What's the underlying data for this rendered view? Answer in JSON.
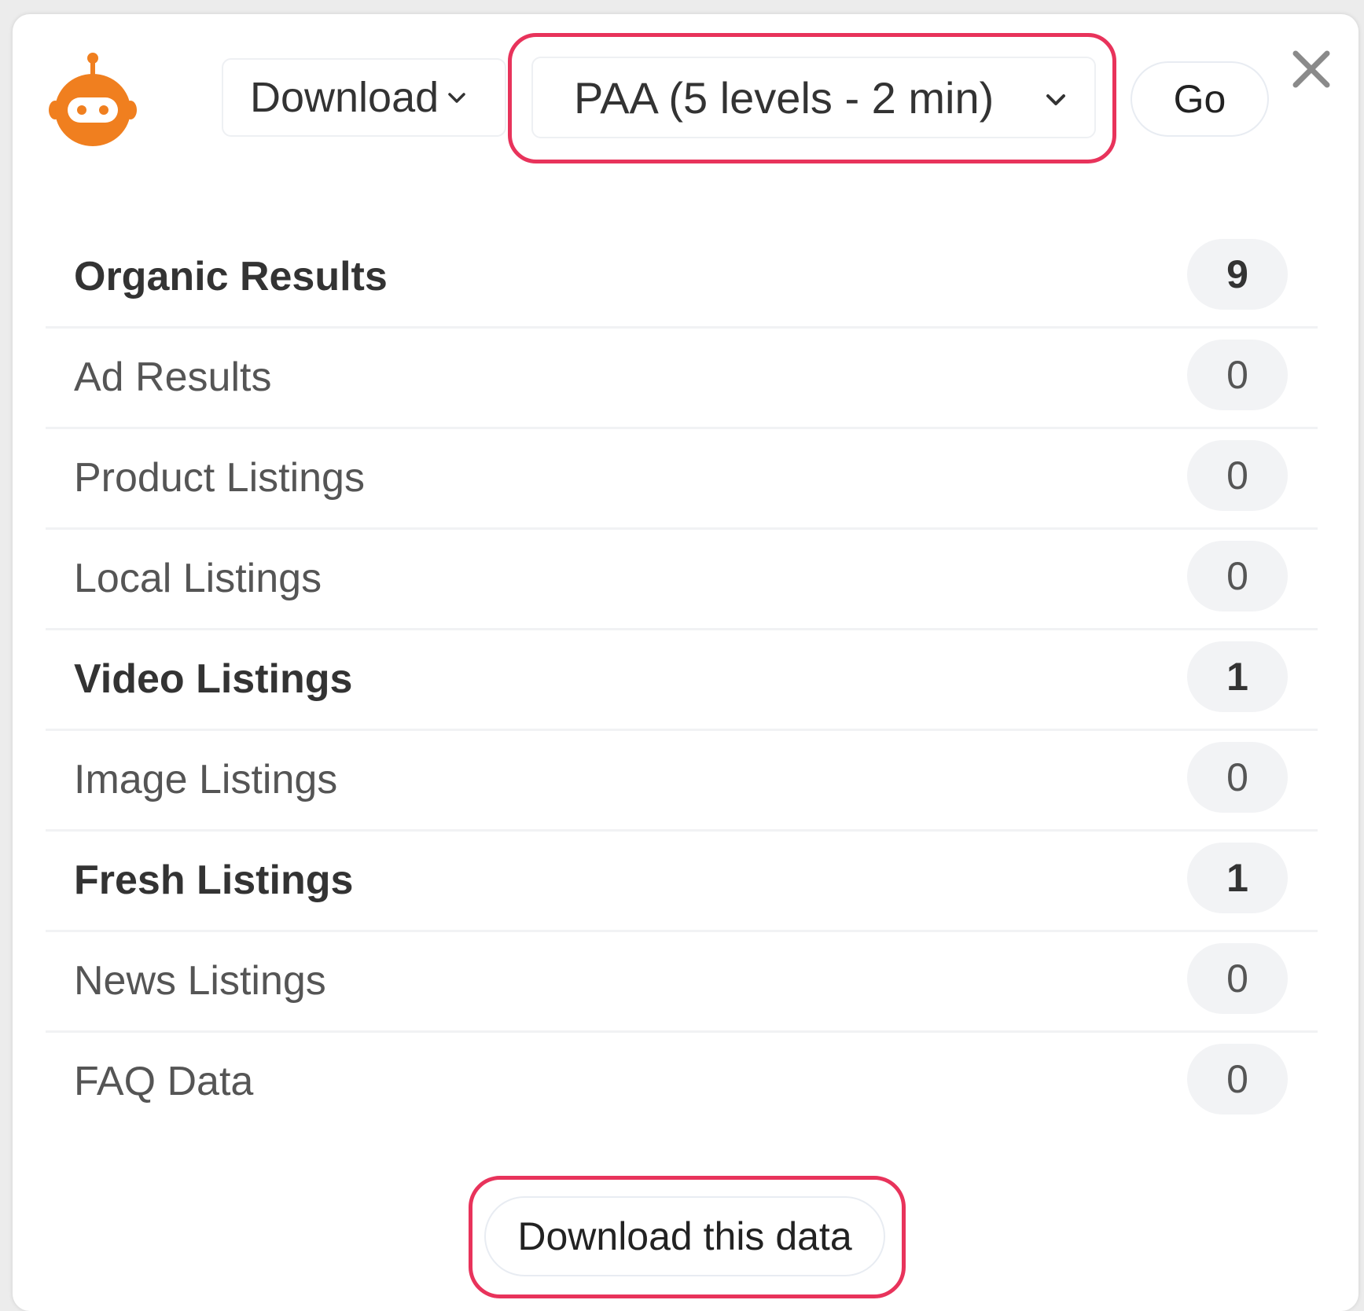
{
  "toolbar": {
    "logo_icon": "robot-icon",
    "download_label": "Download",
    "mode_selected": "PAA (5 levels - 2 min)",
    "go_label": "Go",
    "close_icon": "close-icon"
  },
  "results": [
    {
      "label": "Organic Results",
      "count": "9",
      "emphasis": true
    },
    {
      "label": "Ad Results",
      "count": "0",
      "emphasis": false
    },
    {
      "label": "Product Listings",
      "count": "0",
      "emphasis": false
    },
    {
      "label": "Local Listings",
      "count": "0",
      "emphasis": false
    },
    {
      "label": "Video Listings",
      "count": "1",
      "emphasis": true
    },
    {
      "label": "Image Listings",
      "count": "0",
      "emphasis": false
    },
    {
      "label": "Fresh Listings",
      "count": "1",
      "emphasis": true
    },
    {
      "label": "News Listings",
      "count": "0",
      "emphasis": false
    },
    {
      "label": "FAQ Data",
      "count": "0",
      "emphasis": false
    }
  ],
  "footer": {
    "download_data_label": "Download this data"
  },
  "colors": {
    "accent_orange": "#f07f1f",
    "highlight_red": "#e8335b"
  }
}
